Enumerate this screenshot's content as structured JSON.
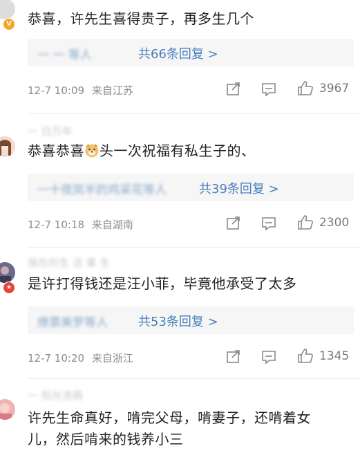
{
  "comments": [
    {
      "username": "",
      "text": "恭喜，许先生喜得贵子，再多生几个",
      "text2": "",
      "reply_prefix": "",
      "reply_count": "共66条回复 >",
      "time": "12-7 10:09",
      "location": "来自江苏",
      "likes": "3967",
      "avatar_icon": "avatar-placeholder",
      "badge": "V"
    },
    {
      "username": "",
      "text_before": "恭喜恭喜",
      "text_after": "头一次祝福有私生子的、",
      "reply_prefix": "",
      "reply_count": "共39条回复 >",
      "time": "12-7 10:18",
      "location": "来自湖南",
      "likes": "2300",
      "avatar_icon": "girl-avatar"
    },
    {
      "username": "",
      "text": "是许打得钱还是汪小菲，毕竟他承受了太多",
      "reply_prefix": "",
      "reply_count": "共53条回复 >",
      "time": "12-7 10:20",
      "location": "来自浙江",
      "likes": "1345",
      "avatar_icon": "avatar-dark",
      "badge": "★"
    },
    {
      "username": "",
      "text": "许先生命真好，啃完父母，啃妻子，还啃着女",
      "text2": "儿，然后啃来的钱养小三",
      "avatar_icon": "avatar-pink"
    }
  ],
  "icons": {
    "repost": "repost-icon",
    "comment": "comment-icon",
    "like": "like-icon",
    "emoji": "dog-emoji-icon"
  },
  "colors": {
    "link": "#4a7fbf",
    "meta": "#8c8c8c",
    "reply_bg": "#f6f6f6"
  }
}
